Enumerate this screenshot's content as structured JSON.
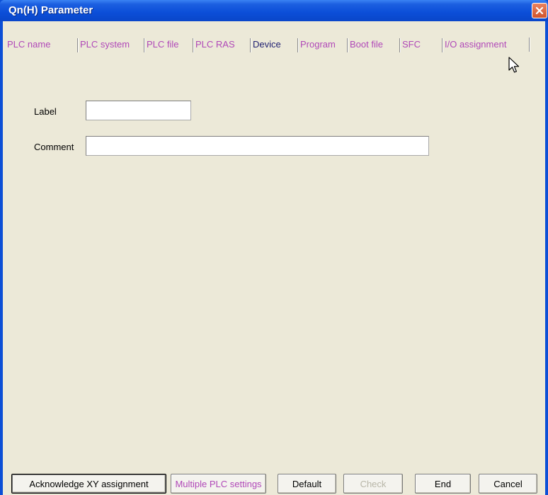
{
  "window": {
    "title": "Qn(H) Parameter"
  },
  "tabs": [
    {
      "label": "PLC name"
    },
    {
      "label": "PLC system"
    },
    {
      "label": "PLC file"
    },
    {
      "label": "PLC RAS"
    },
    {
      "label": "Device"
    },
    {
      "label": "Program"
    },
    {
      "label": "Boot file"
    },
    {
      "label": "SFC"
    },
    {
      "label": "I/O assignment"
    }
  ],
  "active_tab": "PLC name",
  "form": {
    "label": {
      "caption": "Label",
      "value": ""
    },
    "comment": {
      "caption": "Comment",
      "value": ""
    }
  },
  "buttons": {
    "acknowledge": "Acknowledge XY assignment",
    "multiple_plc": "Multiple PLC settings",
    "default": "Default",
    "check": "Check",
    "end": "End",
    "cancel": "Cancel"
  },
  "colors": {
    "title_bar": "#0b4ed8",
    "dialog_bg": "#ece9d8",
    "tab_text": "#b048b8",
    "close_button": "#d2542c"
  },
  "icons": [
    "close-icon",
    "mouse-cursor-icon"
  ]
}
